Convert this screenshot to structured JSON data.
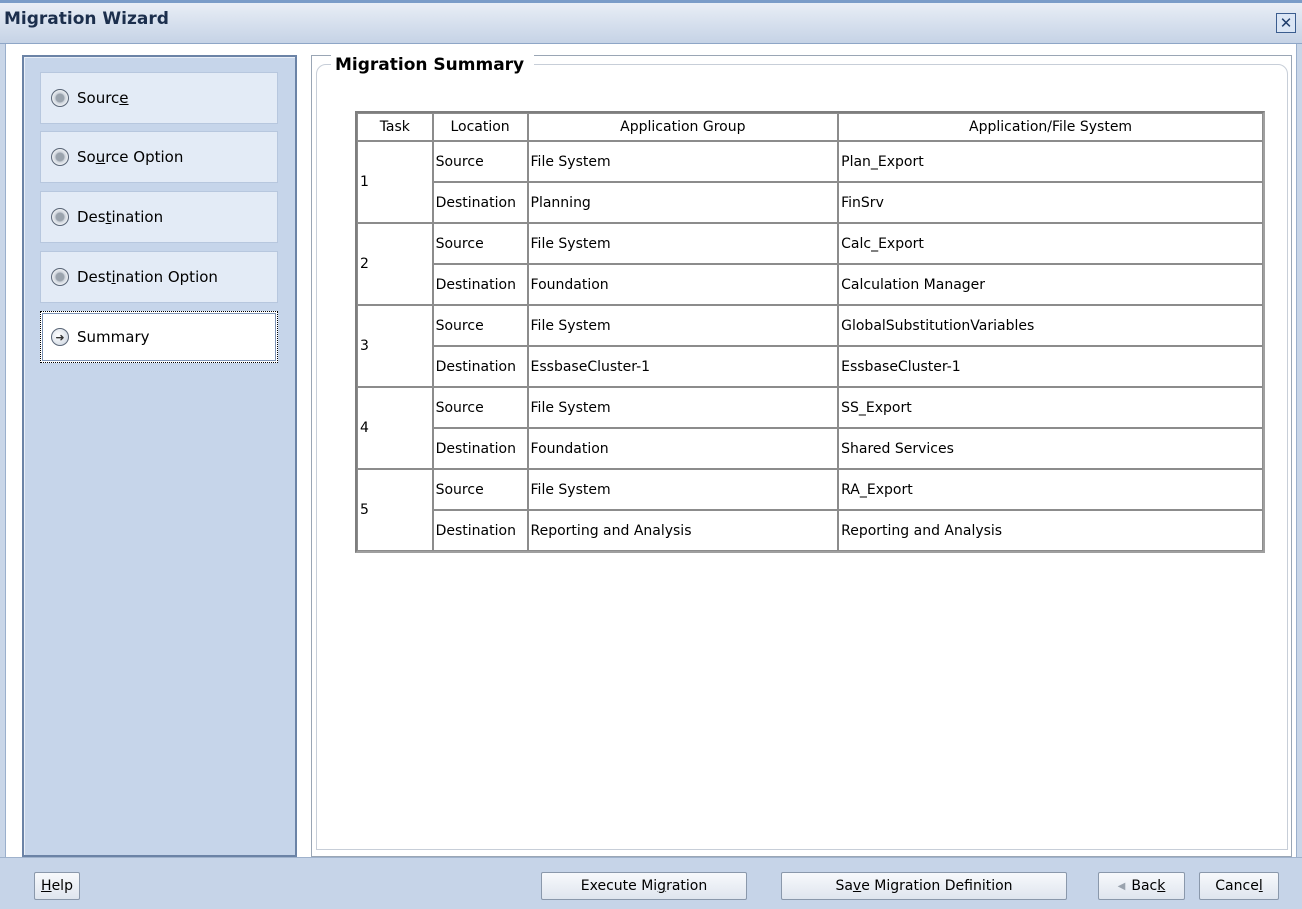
{
  "window": {
    "title": "Migration Wizard",
    "close_symbol": "✕"
  },
  "sidebar": {
    "items": [
      {
        "label": "Source",
        "icon": "radio-icon",
        "state": "inactive"
      },
      {
        "label": "Source Option",
        "icon": "radio-icon",
        "state": "inactive"
      },
      {
        "label": "Destination",
        "icon": "radio-icon",
        "state": "inactive"
      },
      {
        "label": "Destination Option",
        "icon": "radio-icon",
        "state": "inactive"
      },
      {
        "label": "Summary",
        "icon": "arrow-right-icon",
        "state": "active"
      }
    ]
  },
  "summary": {
    "title": "Migration Summary",
    "columns": [
      "Task",
      "Location",
      "Application Group",
      "Application/File System"
    ],
    "tasks": [
      {
        "task": "1",
        "rows": [
          {
            "location": "Source",
            "group": "File System",
            "app": "Plan_Export"
          },
          {
            "location": "Destination",
            "group": "Planning",
            "app": "FinSrv"
          }
        ]
      },
      {
        "task": "2",
        "rows": [
          {
            "location": "Source",
            "group": "File System",
            "app": "Calc_Export"
          },
          {
            "location": "Destination",
            "group": "Foundation",
            "app": "Calculation Manager"
          }
        ]
      },
      {
        "task": "3",
        "rows": [
          {
            "location": "Source",
            "group": "File System",
            "app": "GlobalSubstitutionVariables"
          },
          {
            "location": "Destination",
            "group": "EssbaseCluster-1",
            "app": "EssbaseCluster-1"
          }
        ]
      },
      {
        "task": "4",
        "rows": [
          {
            "location": "Source",
            "group": "File System",
            "app": "SS_Export"
          },
          {
            "location": "Destination",
            "group": "Foundation",
            "app": "Shared Services"
          }
        ]
      },
      {
        "task": "5",
        "rows": [
          {
            "location": "Source",
            "group": "File System",
            "app": "RA_Export"
          },
          {
            "location": "Destination",
            "group": "Reporting and Analysis",
            "app": "Reporting and Analysis"
          }
        ]
      }
    ]
  },
  "footer": {
    "help": {
      "pre": "",
      "key": "H",
      "post": "elp"
    },
    "execute": {
      "pre": "Execute Mi",
      "key": "g",
      "post": "ration"
    },
    "save": {
      "pre": "Sa",
      "key": "v",
      "post": "e Migration Definition"
    },
    "back": {
      "pre": "Bac",
      "key": "k",
      "post": ""
    },
    "cancel": {
      "pre": "Cance",
      "key": "l",
      "post": ""
    }
  },
  "mnemonics": {
    "source": {
      "pre": "Sourc",
      "key": "e",
      "post": ""
    },
    "source_option": {
      "pre": "So",
      "key": "u",
      "post": "rce Option"
    },
    "destination": {
      "pre": "Des",
      "key": "t",
      "post": "ination"
    },
    "destination_option": {
      "pre": "Dest",
      "key": "i",
      "post": "nation Option"
    },
    "summary": {
      "pre": "Summary",
      "key": "",
      "post": ""
    }
  }
}
